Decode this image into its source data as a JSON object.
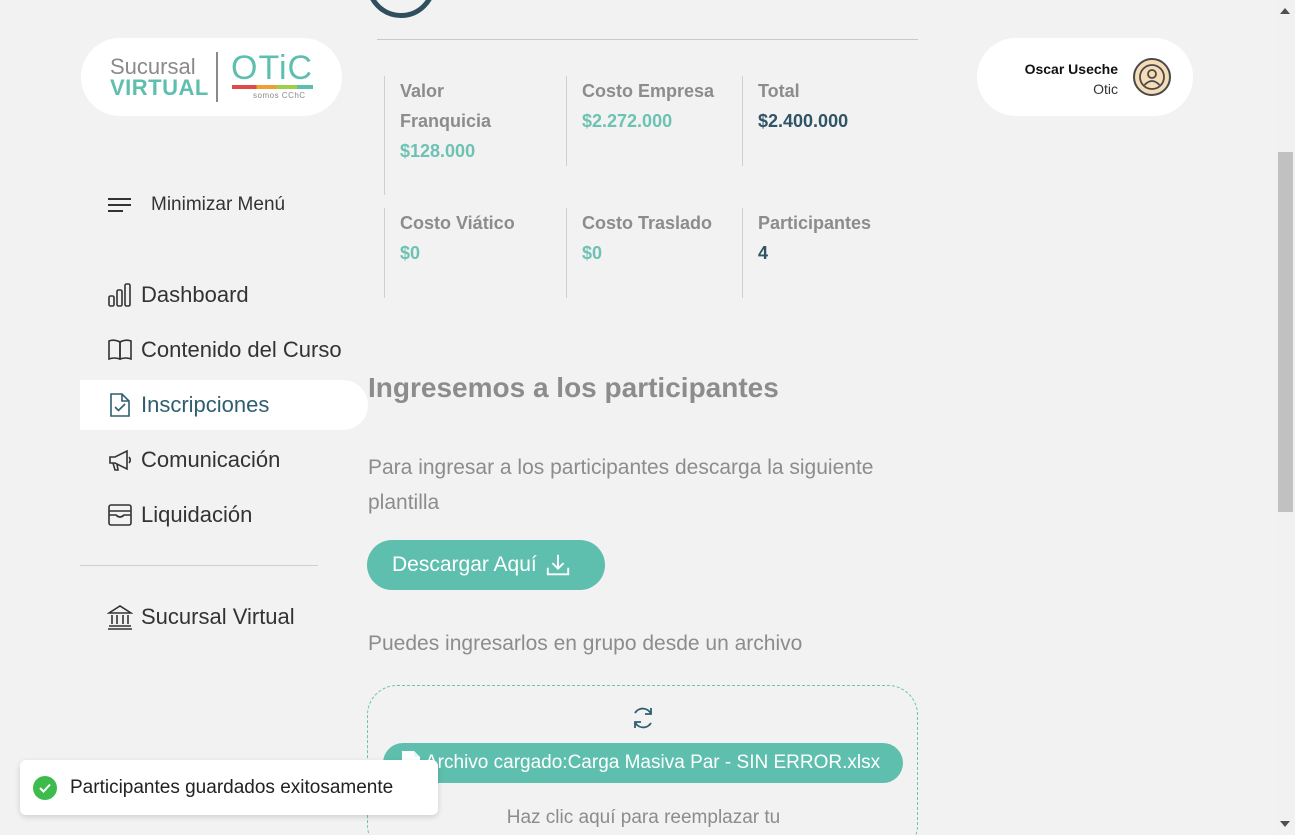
{
  "logo": {
    "line1": "Sucursal",
    "line2": "VIRTUAL",
    "brand": "OTiC",
    "tagline": "somos CChC"
  },
  "user": {
    "name": "Oscar Useche",
    "org": "Otic"
  },
  "sidebar": {
    "minimize_label": "Minimizar Menú",
    "items": [
      {
        "label": "Dashboard",
        "icon": "bar-chart-icon"
      },
      {
        "label": "Contenido del Curso",
        "icon": "book-icon"
      },
      {
        "label": "Inscripciones",
        "icon": "document-check-icon",
        "active": true
      },
      {
        "label": "Comunicación",
        "icon": "megaphone-icon"
      },
      {
        "label": "Liquidación",
        "icon": "archive-icon"
      }
    ],
    "footer_item": {
      "label": "Sucursal Virtual",
      "icon": "bank-icon"
    }
  },
  "costs": {
    "valor_franquicia": {
      "label": "Valor Franquicia",
      "value": "$128.000"
    },
    "costo_empresa": {
      "label": "Costo Empresa",
      "value": "$2.272.000"
    },
    "total": {
      "label": "Total",
      "value": "$2.400.000"
    },
    "costo_viatico": {
      "label": "Costo Viático",
      "value": "$0"
    },
    "costo_traslado": {
      "label": "Costo Traslado",
      "value": "$0"
    },
    "participantes": {
      "label": "Participantes",
      "value": "4"
    }
  },
  "main": {
    "title": "Ingresemos a los participantes",
    "instructions": "Para ingresar a los participantes descarga la siguiente plantilla",
    "download_label": "Descargar Aquí",
    "group_text": "Puedes ingresarlos en grupo desde un archivo",
    "file_chip": "Archivo cargado:Carga Masiva Par - SIN ERROR.xlsx",
    "replace_text": "Haz clic aquí para reemplazar tu"
  },
  "toast": {
    "message": "Participantes guardados exitosamente"
  },
  "colors": {
    "accent": "#5fbfae",
    "navy": "#2f5466",
    "muted": "#8c8c8c",
    "success": "#3dbb4d"
  }
}
